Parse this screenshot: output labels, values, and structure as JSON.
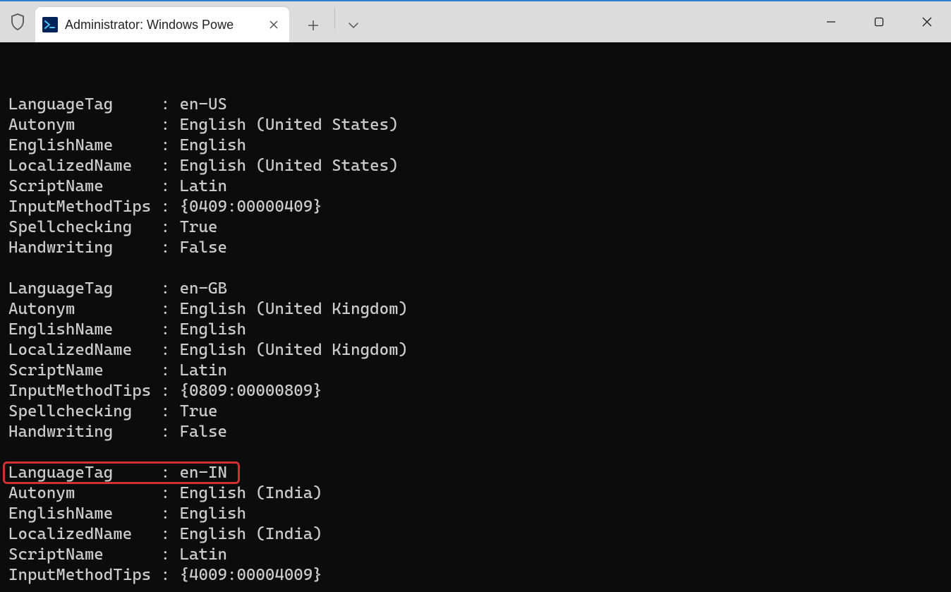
{
  "window": {
    "tab_title": "Administrator: Windows Powe",
    "controls": {
      "minimize": "minimize",
      "maximize": "maximize",
      "close": "close"
    }
  },
  "labels": {
    "LanguageTag": "LanguageTag",
    "Autonym": "Autonym",
    "EnglishName": "EnglishName",
    "LocalizedName": "LocalizedName",
    "ScriptName": "ScriptName",
    "InputMethodTips": "InputMethodTips",
    "Spellchecking": "Spellchecking",
    "Handwriting": "Handwriting"
  },
  "blocks": [
    {
      "LanguageTag": "en-US",
      "Autonym": "English (United States)",
      "EnglishName": "English",
      "LocalizedName": "English (United States)",
      "ScriptName": "Latin",
      "InputMethodTips": "{0409:00000409}",
      "Spellchecking": "True",
      "Handwriting": "False"
    },
    {
      "LanguageTag": "en-GB",
      "Autonym": "English (United Kingdom)",
      "EnglishName": "English",
      "LocalizedName": "English (United Kingdom)",
      "ScriptName": "Latin",
      "InputMethodTips": "{0809:00000809}",
      "Spellchecking": "True",
      "Handwriting": "False"
    },
    {
      "LanguageTag": "en-IN",
      "Autonym": "English (India)",
      "EnglishName": "English",
      "LocalizedName": "English (India)",
      "ScriptName": "Latin",
      "InputMethodTips": "{4009:00004009}"
    }
  ],
  "highlight": {
    "block_index": 2,
    "field": "LanguageTag"
  },
  "colors": {
    "accent_border": "#d03030",
    "terminal_bg": "#0c0c0c",
    "terminal_fg": "#cccccc",
    "titlebar_bg": "#dcdcdc",
    "tab_bg": "#ffffff",
    "ps_icon_bg": "#012456"
  }
}
